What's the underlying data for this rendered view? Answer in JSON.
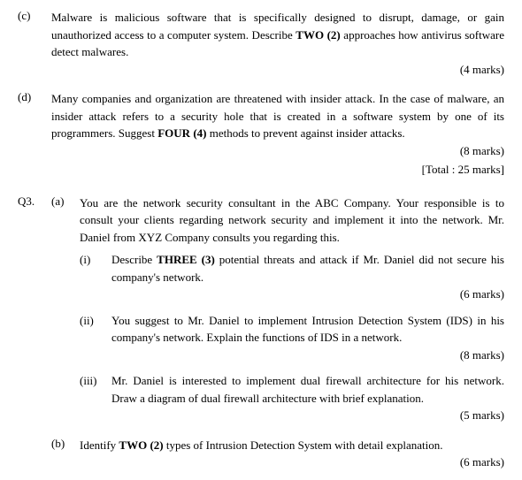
{
  "sections": {
    "c": {
      "label": "(c)",
      "text": "Malware is malicious software that is specifically designed to disrupt, damage, or gain unauthorized access to a computer system. Describe ",
      "bold1": "TWO (2)",
      "text2": " approaches how antivirus software detect malwares.",
      "marks": "(4 marks)"
    },
    "d": {
      "label": "(d)",
      "text": "Many companies and organization are threatened with insider attack. In the case of malware, an insider attack refers to a security hole that is created in a software system by one of its programmers. Suggest ",
      "bold1": "FOUR (4)",
      "text2": " methods to prevent against insider attacks.",
      "marks": "(8 marks)",
      "total": "[Total : 25 marks]"
    },
    "q3": {
      "label": "Q3.",
      "a": {
        "label": "(a)",
        "text": "You are the network security consultant in the ABC Company. Your responsible is to consult your clients regarding network security and implement it into the network. Mr. Daniel from XYZ Company consults you regarding this.",
        "subquestions": [
          {
            "label": "(i)",
            "text": "Describe ",
            "bold": "THREE (3)",
            "text2": " potential threats and attack if Mr. Daniel did not secure his company's network.",
            "marks": "(6 marks)"
          },
          {
            "label": "(ii)",
            "text": "You suggest to Mr. Daniel to implement Intrusion Detection System (IDS) in his company's network. Explain the functions of IDS in a network.",
            "marks": "(8 marks)"
          },
          {
            "label": "(iii)",
            "text": "Mr. Daniel is interested to implement dual firewall architecture for his network. Draw a diagram of dual firewall architecture with brief explanation.",
            "marks": "(5 marks)"
          }
        ]
      },
      "b": {
        "label": "(b)",
        "text": "Identify ",
        "bold": "TWO (2)",
        "text2": " types of Intrusion Detection System with detail explanation.",
        "marks": "(6 marks)"
      }
    }
  }
}
